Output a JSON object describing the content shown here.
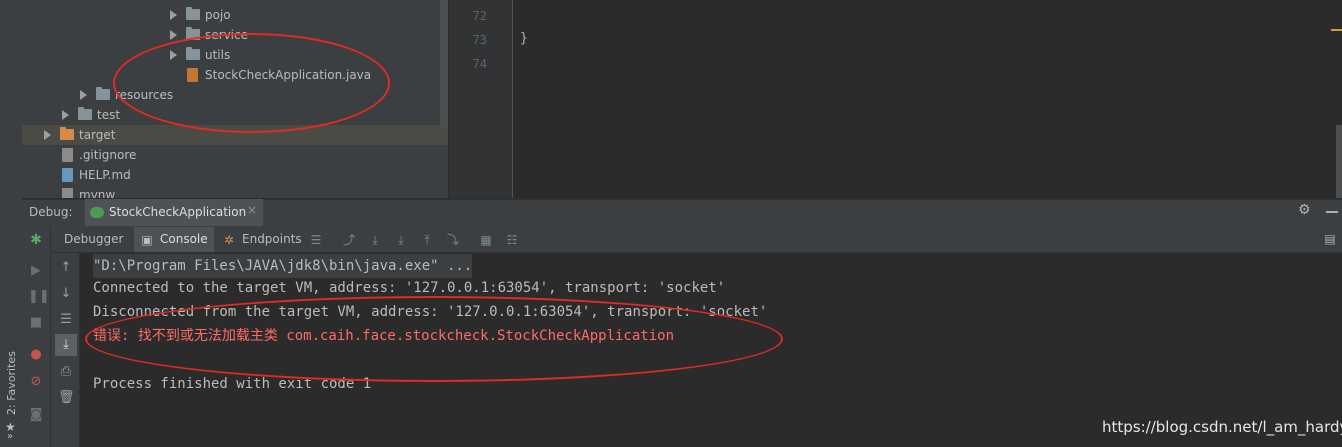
{
  "favorites": {
    "label": "2: Favorites",
    "star": "★",
    "chevron": "»"
  },
  "project_tree": [
    {
      "label": "pojo",
      "type": "folder",
      "expanded": false
    },
    {
      "label": "service",
      "type": "folder",
      "expanded": false
    },
    {
      "label": "utils",
      "type": "folder",
      "expanded": false
    },
    {
      "label": "StockCheckApplication.java",
      "type": "java-file"
    },
    {
      "label": "resources",
      "type": "resources-folder",
      "expanded": false
    },
    {
      "label": "test",
      "type": "folder",
      "expanded": false
    },
    {
      "label": "target",
      "type": "excluded-folder",
      "expanded": false,
      "selected": true
    },
    {
      "label": ".gitignore",
      "type": "file"
    },
    {
      "label": "HELP.md",
      "type": "markdown-file"
    },
    {
      "label": "mvnw",
      "type": "file"
    }
  ],
  "editor": {
    "line_numbers": [
      "72",
      "73",
      "74"
    ],
    "code": "}"
  },
  "debug": {
    "title": "Debug:",
    "run_config": "StockCheckApplication",
    "close_glyph": "×",
    "tabs": {
      "debugger": "Debugger",
      "console": "Console",
      "endpoints": "Endpoints"
    },
    "active_tab": "Console"
  },
  "console": {
    "lines": [
      "\"D:\\Program Files\\JAVA\\jdk8\\bin\\java.exe\" ...",
      "Connected to the target VM, address: '127.0.0.1:63054', transport: 'socket'",
      "Disconnected from the target VM, address: '127.0.0.1:63054', transport: 'socket'",
      "错误: 找不到或无法加载主类 com.caih.face.stockcheck.StockCheckApplication",
      "",
      "Process finished with exit code 1"
    ]
  },
  "colors": {
    "error": "#ff6b68",
    "annotation": "#e12b24",
    "selection": "#4b4b46"
  },
  "watermark": "https://blog.csdn.net/l_am_hardy"
}
